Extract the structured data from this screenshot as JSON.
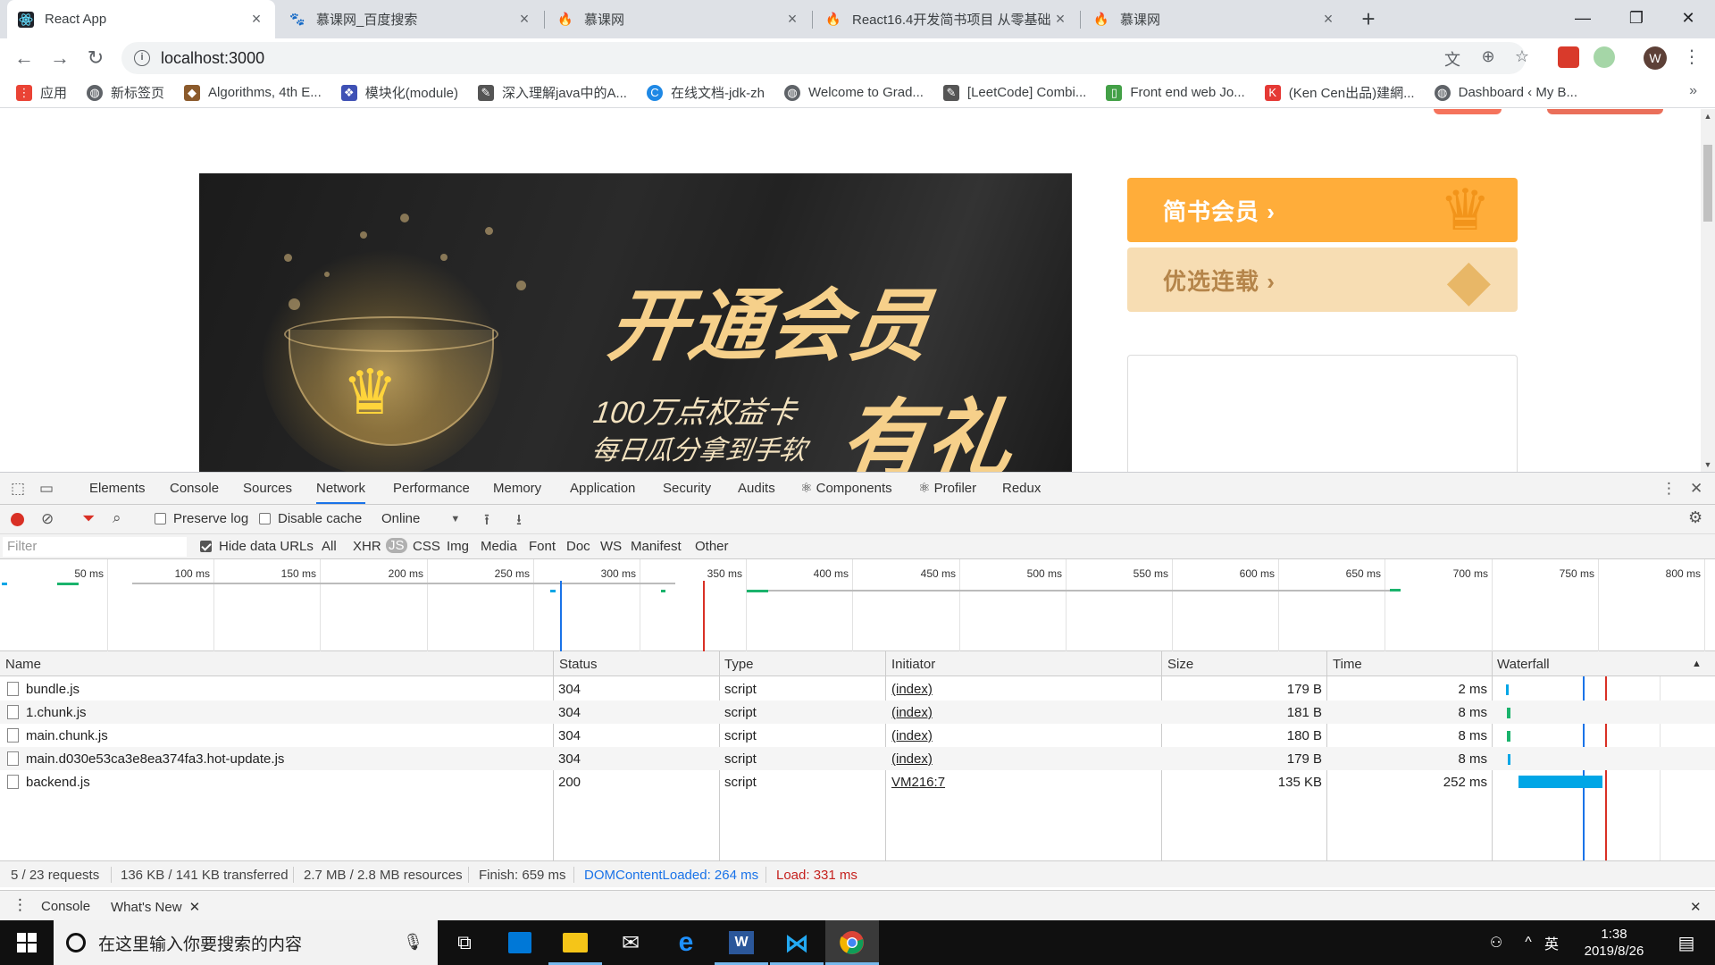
{
  "browser": {
    "tabs": [
      {
        "title": "React App",
        "active": true
      },
      {
        "title": "慕课网_百度搜索",
        "active": false
      },
      {
        "title": "慕课网",
        "active": false
      },
      {
        "title": "React16.4开发简书项目 从零基础",
        "active": false
      },
      {
        "title": "慕课网",
        "active": false
      }
    ],
    "url": "localhost:3000",
    "profile_initial": "W",
    "bookmarks": [
      {
        "label": "应用",
        "color": "#ea4335"
      },
      {
        "label": "新标签页",
        "color": "#5f6368"
      },
      {
        "label": "Algorithms, 4th E...",
        "color": "#8b5a2b"
      },
      {
        "label": "模块化(module)",
        "color": "#3f51b5"
      },
      {
        "label": "深入理解java中的A...",
        "color": "#555555"
      },
      {
        "label": "在线文档-jdk-zh",
        "color": "#1e88e5"
      },
      {
        "label": "Welcome to Grad...",
        "color": "#5f6368"
      },
      {
        "label": "[LeetCode] Combi...",
        "color": "#555555"
      },
      {
        "label": "Front end web Jo...",
        "color": "#43a047"
      },
      {
        "label": "(Ken Cen出品)建網...",
        "color": "#e53935"
      },
      {
        "label": "Dashboard ‹ My B...",
        "color": "#5f6368"
      }
    ]
  },
  "page": {
    "banner": {
      "title": "开通会员",
      "subtitle_1": "100万点权益卡",
      "subtitle_2": "每日瓜分拿到手软",
      "gift": "有礼"
    },
    "side_cards": [
      {
        "label": "简书会员 ›"
      },
      {
        "label": "优选连载 ›"
      }
    ]
  },
  "devtools": {
    "tabs": [
      "Elements",
      "Console",
      "Sources",
      "Network",
      "Performance",
      "Memory",
      "Application",
      "Security",
      "Audits",
      "⚛ Components",
      "⚛ Profiler",
      "Redux"
    ],
    "active_tab": "Network",
    "toolbar": {
      "preserve_log": "Preserve log",
      "disable_cache": "Disable cache",
      "throttling": "Online"
    },
    "filter": {
      "placeholder": "Filter",
      "hide_data_urls": "Hide data URLs",
      "types": [
        "All",
        "XHR",
        "JS",
        "CSS",
        "Img",
        "Media",
        "Font",
        "Doc",
        "WS",
        "Manifest",
        "Other"
      ],
      "selected_type": "JS"
    },
    "overview_ticks": [
      "50 ms",
      "100 ms",
      "150 ms",
      "200 ms",
      "250 ms",
      "300 ms",
      "350 ms",
      "400 ms",
      "450 ms",
      "500 ms",
      "550 ms",
      "600 ms",
      "650 ms",
      "700 ms",
      "750 ms",
      "800 ms"
    ],
    "columns": [
      "Name",
      "Status",
      "Type",
      "Initiator",
      "Size",
      "Time",
      "Waterfall"
    ],
    "requests": [
      {
        "name": "bundle.js",
        "status": "304",
        "type": "script",
        "initiator": "(index)",
        "size": "179 B",
        "time": "2 ms"
      },
      {
        "name": "1.chunk.js",
        "status": "304",
        "type": "script",
        "initiator": "(index)",
        "size": "181 B",
        "time": "8 ms"
      },
      {
        "name": "main.chunk.js",
        "status": "304",
        "type": "script",
        "initiator": "(index)",
        "size": "180 B",
        "time": "8 ms"
      },
      {
        "name": "main.d030e53ca3e8ea374fa3.hot-update.js",
        "status": "304",
        "type": "script",
        "initiator": "(index)",
        "size": "179 B",
        "time": "8 ms"
      },
      {
        "name": "backend.js",
        "status": "200",
        "type": "script",
        "initiator": "VM216:7",
        "size": "135 KB",
        "time": "252 ms"
      }
    ],
    "status": {
      "requests": "5 / 23 requests",
      "transferred": "136 KB / 141 KB transferred",
      "resources": "2.7 MB / 2.8 MB resources",
      "finish": "Finish: 659 ms",
      "dom_loaded": "DOMContentLoaded: 264 ms",
      "load": "Load: 331 ms"
    },
    "drawer_tabs": [
      "Console",
      "What's New"
    ],
    "colors": {
      "accent": "#1a73e8",
      "dom_line": "#1a73e8",
      "load_line": "#d93025",
      "waterfall_bar": "#00a6e6"
    }
  },
  "taskbar": {
    "search_placeholder": "在这里输入你要搜索的内容",
    "ime": "英",
    "time": "1:38",
    "date": "2019/8/26"
  }
}
